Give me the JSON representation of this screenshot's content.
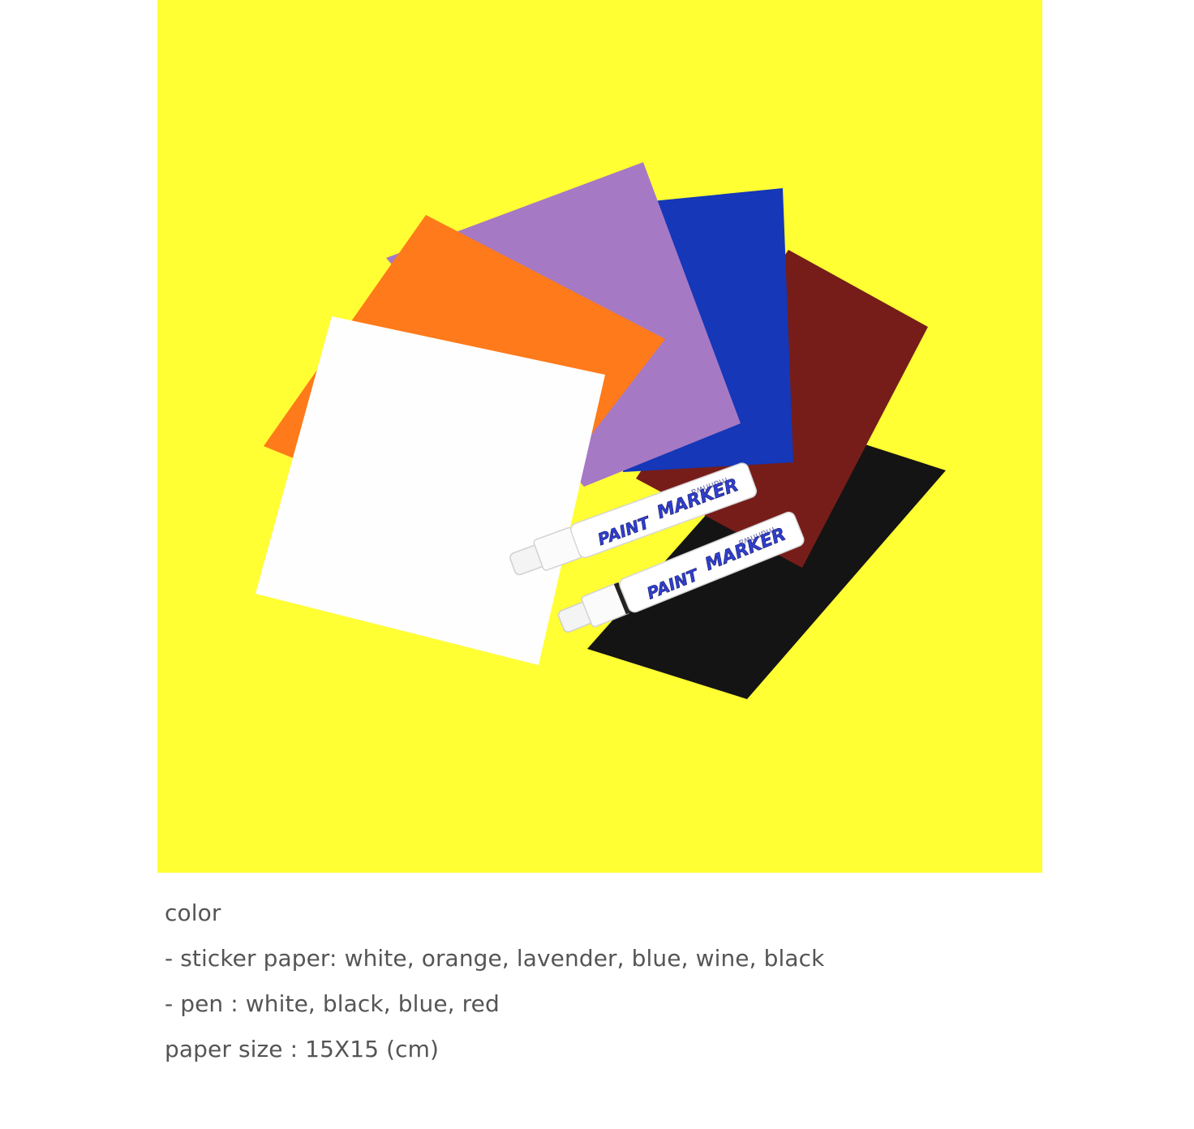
{
  "photo": {
    "background_color": "#ffff33",
    "sheets": [
      {
        "name": "white",
        "color": "#fefefe"
      },
      {
        "name": "orange",
        "color": "#ff7a1a"
      },
      {
        "name": "lavender",
        "color": "#a679c4"
      },
      {
        "name": "blue",
        "color": "#1537b8"
      },
      {
        "name": "wine",
        "color": "#761d1a"
      },
      {
        "name": "black",
        "color": "#151414"
      }
    ],
    "marker_brand": "munhwa",
    "marker_text_paint": "PAINT",
    "marker_text_marker": "MARKER"
  },
  "description": {
    "heading": "color",
    "line_sticker": "- sticker paper: white, orange, lavender, blue, wine, black",
    "line_pen": "- pen : white, black, blue, red",
    "line_size": "paper size : 15X15 (cm)"
  }
}
